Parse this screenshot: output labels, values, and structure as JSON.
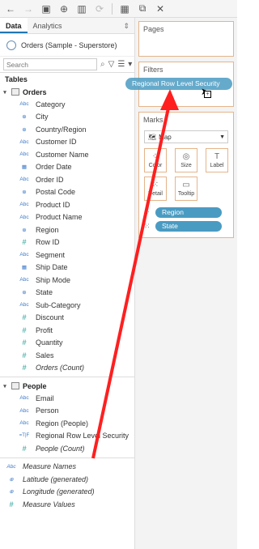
{
  "left_pane": {
    "tabs": [
      "Data",
      "Analytics"
    ],
    "datasource": "Orders (Sample - Superstore)",
    "search_placeholder": "Search",
    "section_title": "Tables",
    "groups": [
      {
        "name": "Orders",
        "fields": [
          {
            "type": "Abc",
            "name": "Category"
          },
          {
            "type": "geo",
            "name": "City"
          },
          {
            "type": "geo",
            "name": "Country/Region"
          },
          {
            "type": "Abc",
            "name": "Customer ID"
          },
          {
            "type": "Abc",
            "name": "Customer Name"
          },
          {
            "type": "date",
            "name": "Order Date"
          },
          {
            "type": "Abc",
            "name": "Order ID"
          },
          {
            "type": "geo",
            "name": "Postal Code"
          },
          {
            "type": "Abc",
            "name": "Product ID"
          },
          {
            "type": "Abc",
            "name": "Product Name"
          },
          {
            "type": "geo",
            "name": "Region"
          },
          {
            "type": "#",
            "name": "Row ID"
          },
          {
            "type": "Abc",
            "name": "Segment"
          },
          {
            "type": "date",
            "name": "Ship Date"
          },
          {
            "type": "Abc",
            "name": "Ship Mode"
          },
          {
            "type": "geo",
            "name": "State"
          },
          {
            "type": "Abc",
            "name": "Sub-Category"
          },
          {
            "type": "#",
            "name": "Discount"
          },
          {
            "type": "#",
            "name": "Profit"
          },
          {
            "type": "#",
            "name": "Quantity"
          },
          {
            "type": "#",
            "name": "Sales"
          },
          {
            "type": "#",
            "name": "Orders (Count)",
            "italic": true
          }
        ]
      },
      {
        "name": "People",
        "fields": [
          {
            "type": "Abc",
            "name": "Email"
          },
          {
            "type": "Abc",
            "name": "Person"
          },
          {
            "type": "Abc",
            "name": "Region (People)"
          },
          {
            "type": "=T|F",
            "name": "Regional Row Level Security"
          },
          {
            "type": "#",
            "name": "People (Count)",
            "italic": true
          }
        ]
      }
    ],
    "loose_fields": [
      {
        "type": "Abc",
        "name": "Measure Names"
      },
      {
        "type": "geo",
        "name": "Latitude (generated)"
      },
      {
        "type": "geo",
        "name": "Longitude (generated)"
      },
      {
        "type": "#",
        "name": "Measure Values"
      }
    ]
  },
  "right_pane": {
    "pages_title": "Pages",
    "filters_title": "Filters",
    "marks_title": "Marks",
    "mark_type": "Map",
    "mark_buttons": [
      "Color",
      "Size",
      "Label",
      "Detail",
      "Tooltip"
    ],
    "pills": [
      "Region",
      "State"
    ]
  },
  "drag_pill": "Regional Row Level Security"
}
